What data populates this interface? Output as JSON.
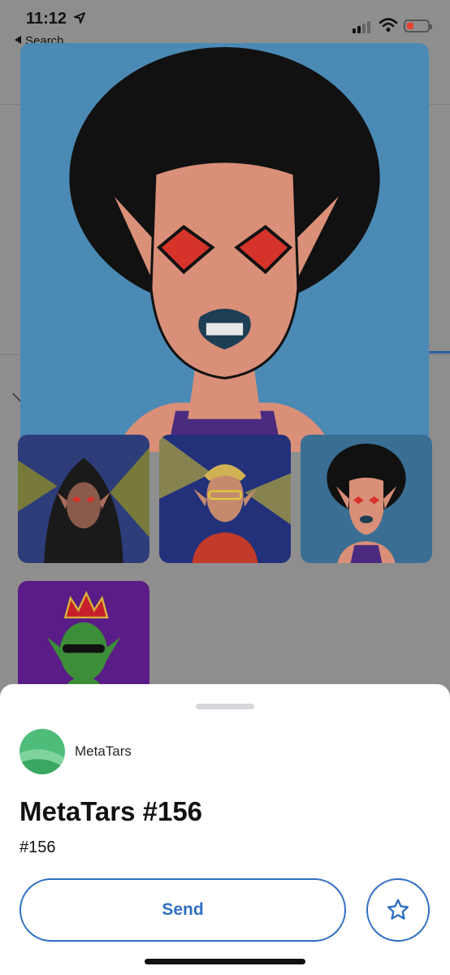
{
  "status_bar": {
    "time": "11:12",
    "back_label": "Search",
    "icons": [
      "location-arrow-icon",
      "cellular-signal-icon",
      "wifi-icon",
      "battery-low-icon"
    ]
  },
  "gallery": {
    "main_image": "nft-portrait-afro-elf",
    "thumbnails": [
      "nft-hooded-cyborg-elf",
      "nft-blonde-cyborg-elf",
      "nft-afro-elf",
      "nft-crowned-green-elf"
    ]
  },
  "sheet": {
    "collection_name": "MetaTars",
    "title": "MetaTars #156",
    "token_id": "#156",
    "send_label": "Send",
    "favorite_icon": "star-icon"
  },
  "colors": {
    "accent": "#2f6fc3",
    "portrait_bg": "#4b8ab5",
    "battery_low": "#e5432e"
  }
}
